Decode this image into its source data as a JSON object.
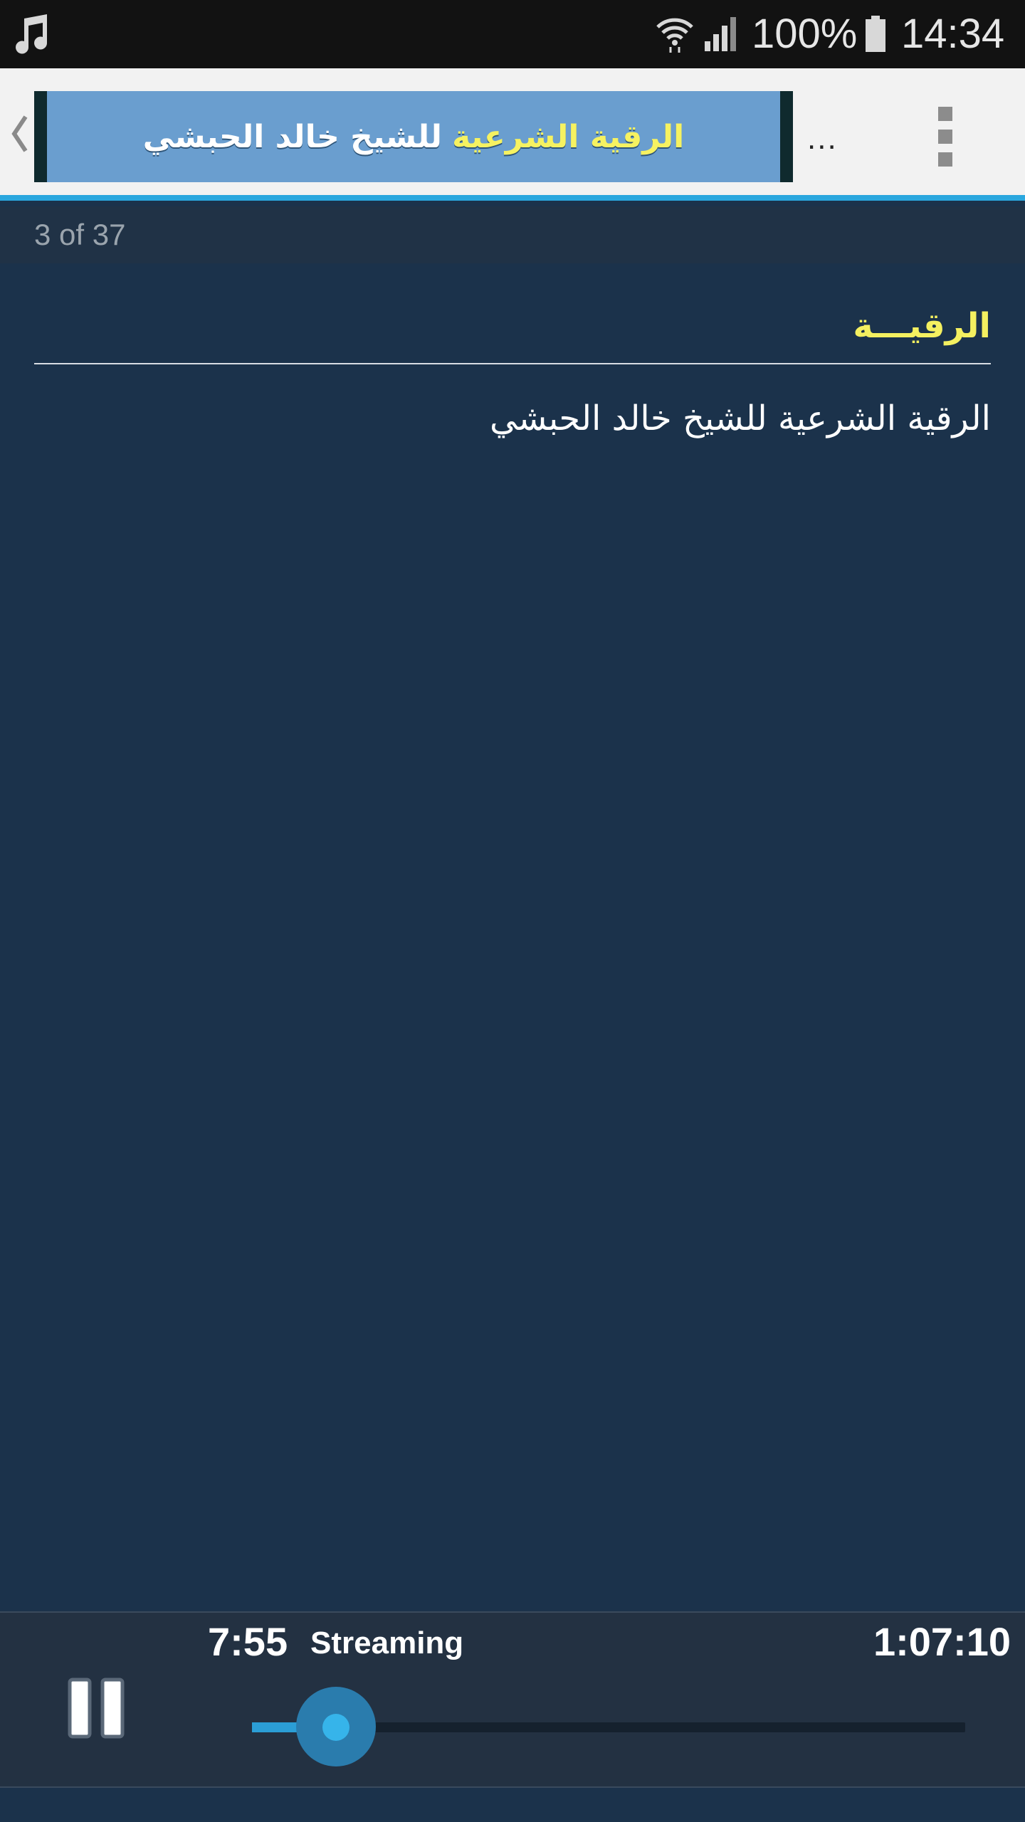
{
  "status_bar": {
    "battery": "100%",
    "time": "14:34"
  },
  "app_bar": {
    "banner": {
      "highlight": "الرقية الشرعية",
      "rest": "للشيخ خالد الحبشي"
    },
    "ellipsis": "..."
  },
  "pager": {
    "indicator": "3 of 37"
  },
  "content": {
    "title": "الرقيـــة",
    "body": "الرقية الشرعية للشيخ خالد الحبشي"
  },
  "player": {
    "elapsed": "7:55",
    "status": "Streaming",
    "duration": "1:07:10",
    "progress": 0.118
  },
  "colors": {
    "accent": "#2aa7de",
    "title_yellow": "#f4f060",
    "background": "#1b324b"
  }
}
